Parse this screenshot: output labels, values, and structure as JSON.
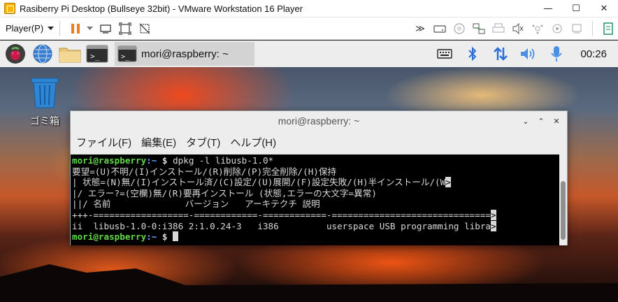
{
  "vmware": {
    "title": "Rasiberry Pi Desktop (Bullseye 32bit) - VMware Workstation 16 Player",
    "player_menu": "Player(P)",
    "window_buttons": {
      "minimize": "—",
      "maximize": "☐",
      "close": "✕"
    },
    "fullscreen_label": "≫"
  },
  "pi_panel": {
    "task_label": "mori@raspberry: ~",
    "clock": "00:26",
    "bluetooth_color": "#2b6fd6"
  },
  "desktop": {
    "trash_label": "ゴミ箱"
  },
  "terminal": {
    "title": "mori@raspberry: ~",
    "controls": {
      "min": "⌄",
      "max": "⌃",
      "close": "✕"
    },
    "menu": [
      "ファイル(F)",
      "編集(E)",
      "タブ(T)",
      "ヘルプ(H)"
    ],
    "prompt_user": "mori@raspberry",
    "prompt_path": ":~",
    "prompt_dollar": " $",
    "command": " dpkg -l libusb-1.0*",
    "output": [
      "要望=(U)不明/(I)インストール/(R)削除/(P)完全削除/(H)保持",
      "| 状態=(N)無/(I)インストール済/(C)設定/(U)展開/(F)設定失敗/(H)半インストール/(W",
      "|/ エラー?=(空欄)無/(R)要再インストール (状態,エラーの大文字=異常)",
      "||/ 名前              バージョン   アーキテクチ 説明",
      "+++-==================-============-============-==============================",
      "ii  libusb-1.0-0:i386 2:1.0.24-3   i386         userspace USB programming libra"
    ],
    "trunc_marker": ">"
  }
}
